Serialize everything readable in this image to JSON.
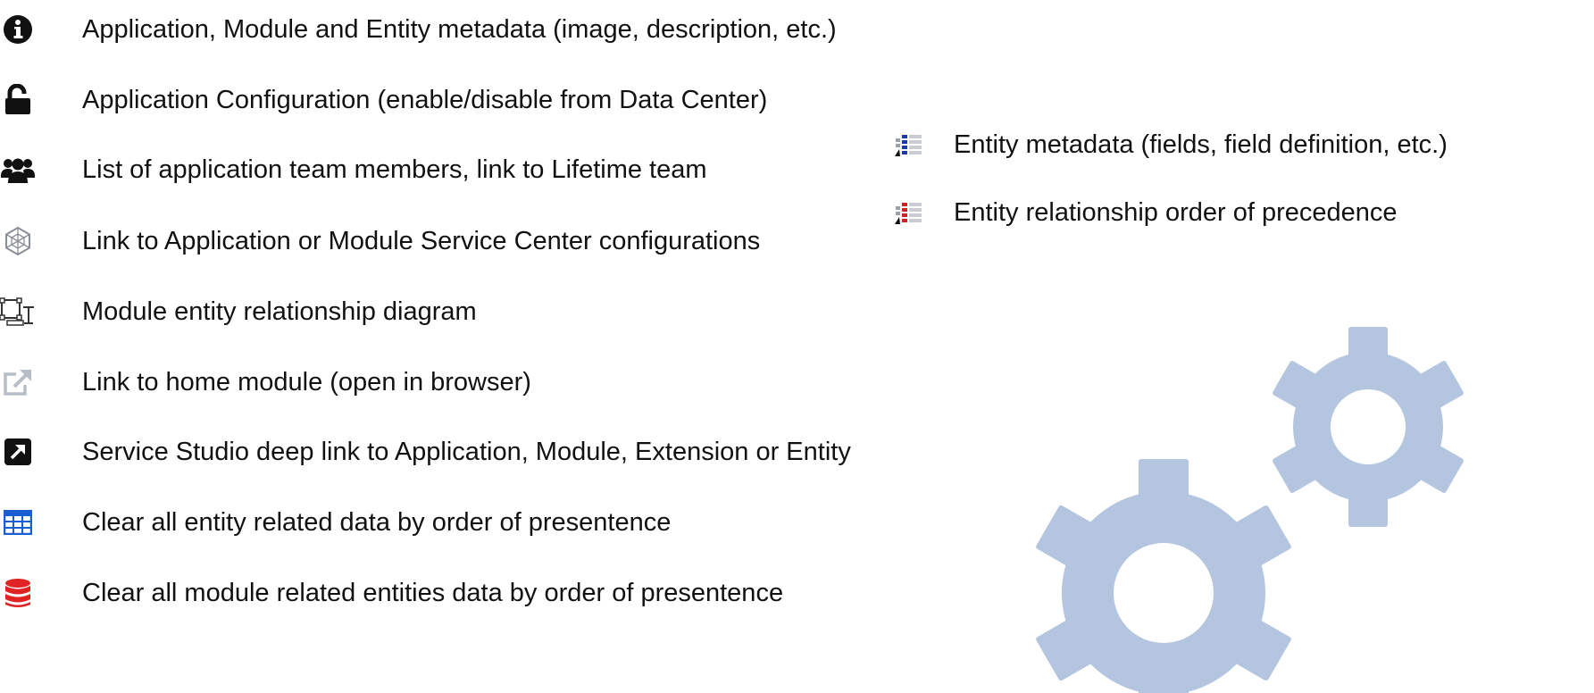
{
  "left_legend": [
    {
      "icon": "info-circle-icon",
      "label": "Application, Module and Entity metadata (image, description, etc.)"
    },
    {
      "icon": "unlock-icon",
      "label": "Application Configuration (enable/disable from Data Center)"
    },
    {
      "icon": "users-icon",
      "label": "List of application team members, link to Lifetime team"
    },
    {
      "icon": "service-center-icon",
      "label": "Link to Application or Module Service Center configurations"
    },
    {
      "icon": "diagram-icon",
      "label": "Module entity relationship diagram"
    },
    {
      "icon": "external-link-icon",
      "label": "Link to home module (open in browser)"
    },
    {
      "icon": "deep-link-icon",
      "label": "Service Studio deep link to Application, Module, Extension or Entity"
    },
    {
      "icon": "table-icon",
      "label": "Clear all entity related data by order of presentence"
    },
    {
      "icon": "database-icon",
      "label": "Clear all module related entities data by order of presentence"
    }
  ],
  "right_legend": [
    {
      "icon": "entity-metadata-icon",
      "label": "Entity metadata (fields, field definition, etc.)"
    },
    {
      "icon": "entity-relationship-order-icon",
      "label": "Entity relationship order of precedence"
    }
  ],
  "colors": {
    "text": "#111111",
    "gear": "#b4c6df",
    "table_icon": "#1a5fd1",
    "database_icon": "#e02424",
    "light_icon": "#b8bec7"
  }
}
